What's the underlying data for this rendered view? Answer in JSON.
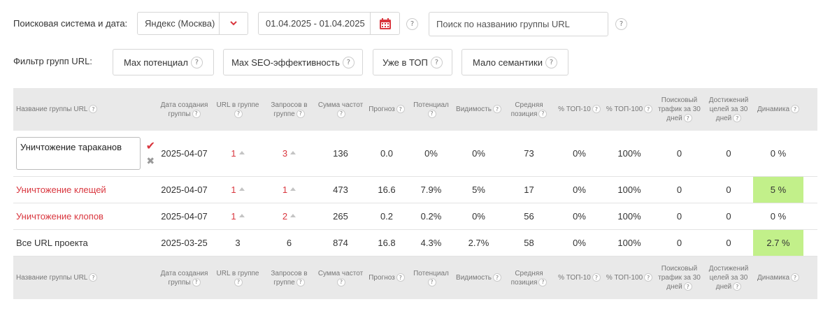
{
  "controls": {
    "engine_label": "Поисковая система и дата:",
    "engine_value": "Яндекс (Москва)",
    "date_value": "01.04.2025 - 01.04.2025",
    "search_placeholder": "Поиск по названию группы URL",
    "filter_label": "Фильтр групп URL:",
    "help_glyph": "?"
  },
  "filters": [
    {
      "label": "Max потенциал"
    },
    {
      "label": "Max SEO-эффективность"
    },
    {
      "label": "Уже в ТОП"
    },
    {
      "label": "Мало семантики"
    }
  ],
  "columns": [
    {
      "l1": "Название группы URL",
      "l2": "",
      "l3": ""
    },
    {
      "l1": "Дата создания",
      "l2": "группы",
      "l3": ""
    },
    {
      "l1": "URL в группе",
      "l2": "",
      "l3": ""
    },
    {
      "l1": "Запросов в",
      "l2": "группе",
      "l3": ""
    },
    {
      "l1": "Сумма частот",
      "l2": "",
      "l3": ""
    },
    {
      "l1": "Прогноз",
      "l2": "",
      "l3": ""
    },
    {
      "l1": "Потенциал",
      "l2": "",
      "l3": ""
    },
    {
      "l1": "Видимость",
      "l2": "",
      "l3": ""
    },
    {
      "l1": "Средняя",
      "l2": "позиция",
      "l3": ""
    },
    {
      "l1": "% ТОП-10",
      "l2": "",
      "l3": ""
    },
    {
      "l1": "% ТОП-100",
      "l2": "",
      "l3": ""
    },
    {
      "l1": "Поисковый",
      "l2": "трафик за 30",
      "l3": "дней"
    },
    {
      "l1": "Достижений",
      "l2": "целей за 30",
      "l3": "дней"
    },
    {
      "l1": "Динамика",
      "l2": "",
      "l3": ""
    }
  ],
  "rows": [
    {
      "name": "Уничтожение тараканов",
      "date": "2025-04-07",
      "urls": "1",
      "queries": "3",
      "freq": "136",
      "forecast": "0.0",
      "potential": "0%",
      "visibility": "0%",
      "avg_pos": "73",
      "top10": "0%",
      "top100": "100%",
      "traffic": "0",
      "goals": "0",
      "dynamics": "0 %"
    },
    {
      "name": "Уничтожение клещей",
      "date": "2025-04-07",
      "urls": "1",
      "queries": "1",
      "freq": "473",
      "forecast": "16.6",
      "potential": "7.9%",
      "visibility": "5%",
      "avg_pos": "17",
      "top10": "0%",
      "top100": "100%",
      "traffic": "0",
      "goals": "0",
      "dynamics": "5 %"
    },
    {
      "name": "Уничтожение клопов",
      "date": "2025-04-07",
      "urls": "1",
      "queries": "2",
      "freq": "265",
      "forecast": "0.2",
      "potential": "0.2%",
      "visibility": "0%",
      "avg_pos": "56",
      "top10": "0%",
      "top100": "100%",
      "traffic": "0",
      "goals": "0",
      "dynamics": "0 %"
    },
    {
      "name": "Все URL проекта",
      "date": "2025-03-25",
      "urls": "3",
      "queries": "6",
      "freq": "874",
      "forecast": "16.8",
      "potential": "4.3%",
      "visibility": "2.7%",
      "avg_pos": "58",
      "top10": "0%",
      "top100": "100%",
      "traffic": "0",
      "goals": "0",
      "dynamics": "2.7 %"
    }
  ],
  "colors": {
    "accent_red": "#d9363e",
    "dynamics_positive": "#c2f08a",
    "header_bg": "#e9e9e9"
  },
  "icons": [
    "chevron-down-icon",
    "calendar-icon",
    "help-icon",
    "sort-triangle-icon",
    "check-icon",
    "cross-icon"
  ]
}
